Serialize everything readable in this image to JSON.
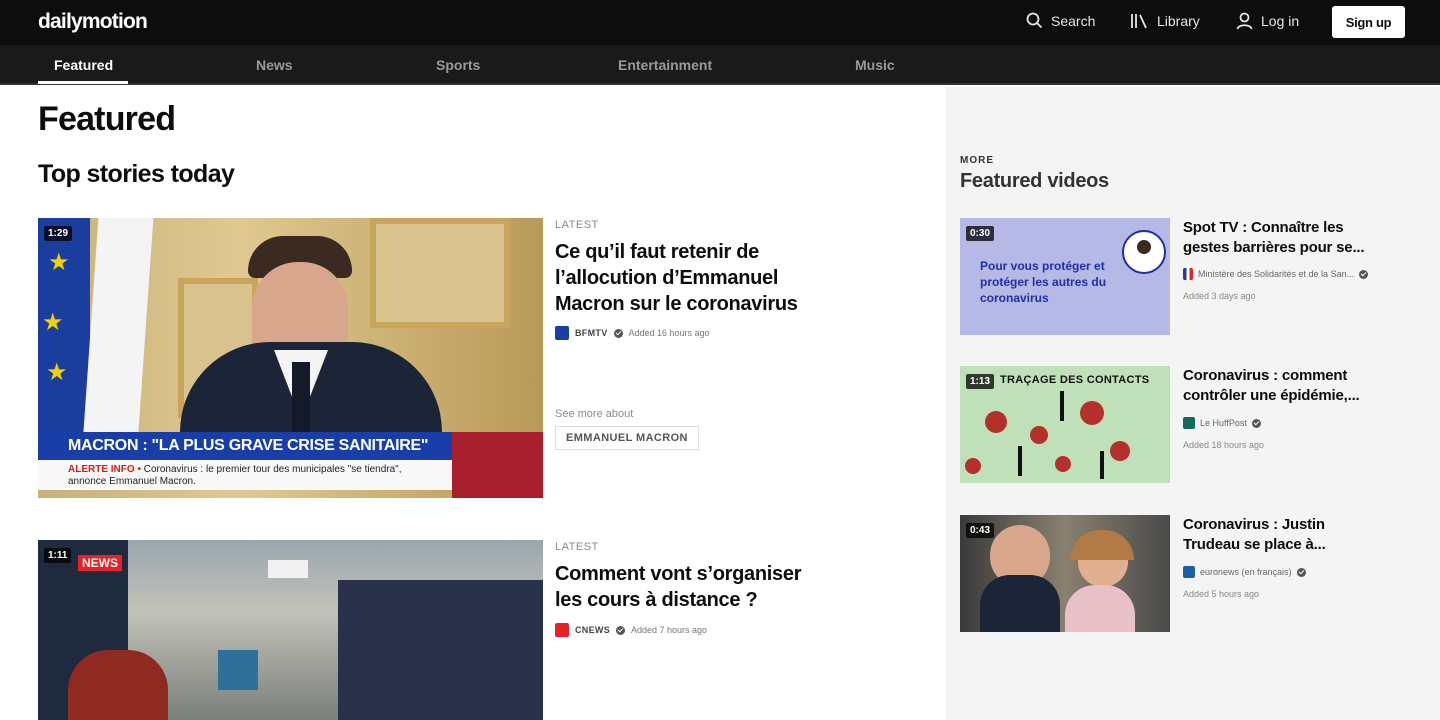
{
  "header": {
    "logo": "dailymotion",
    "search_label": "Search",
    "library_label": "Library",
    "login_label": "Log in",
    "signup_label": "Sign up"
  },
  "categories": [
    {
      "label": "Featured",
      "active": true
    },
    {
      "label": "News"
    },
    {
      "label": "Sports"
    },
    {
      "label": "Entertainment"
    },
    {
      "label": "Music"
    }
  ],
  "main": {
    "page_title": "Featured",
    "section_title": "Top stories today",
    "stories": [
      {
        "label": "LATEST",
        "duration": "1:29",
        "title_lines": [
          "Ce qu’il faut retenir de",
          "l’allocution d’Emmanuel",
          "Macron sur le coronavirus"
        ],
        "channel": "BFMTV",
        "added": "Added 16 hours ago",
        "see_more": "See more about",
        "tag": "EMMANUEL MACRON",
        "overlay_headline": "MACRON : \"LA PLUS GRAVE CRISE SANITAIRE\"",
        "overlay_alert": "ALERTE INFO •",
        "overlay_sub": "Coronavirus : le premier tour des municipales \"se tiendra\", annonce Emmanuel Macron."
      },
      {
        "label": "LATEST",
        "duration": "1:11",
        "title_lines": [
          "Comment vont s’organiser",
          "les cours à distance ?"
        ],
        "channel": "CNEWS",
        "added": "Added 7 hours ago",
        "overlay_tag": "NEWS"
      }
    ]
  },
  "sidebar": {
    "more_label": "MORE",
    "title": "Featured videos",
    "videos": [
      {
        "duration": "0:30",
        "thumb_text": "Pour vous protéger et protéger les autres du coronavirus",
        "title": "Spot TV : Connaître les gestes barrières pour se...",
        "channel": "Ministère des Solidarités et de la San...",
        "added": "Added 3 days ago"
      },
      {
        "duration": "1:13",
        "thumb_text": "TRAÇAGE DES CONTACTS",
        "title": "Coronavirus : comment contrôler une épidémie,...",
        "channel": "Le HuffPost",
        "added": "Added 18 hours ago"
      },
      {
        "duration": "0:43",
        "title": "Coronavirus : Justin Trudeau se place à...",
        "channel": "euronews (en français)",
        "added": "Added 5 hours ago"
      }
    ]
  },
  "colors": {
    "topbar": "#0d0d0d",
    "catbar": "#1a1a1a",
    "right_panel": "#f4f4f4",
    "bfmtv": "#1a3ea8",
    "cnews": "#e42326"
  }
}
